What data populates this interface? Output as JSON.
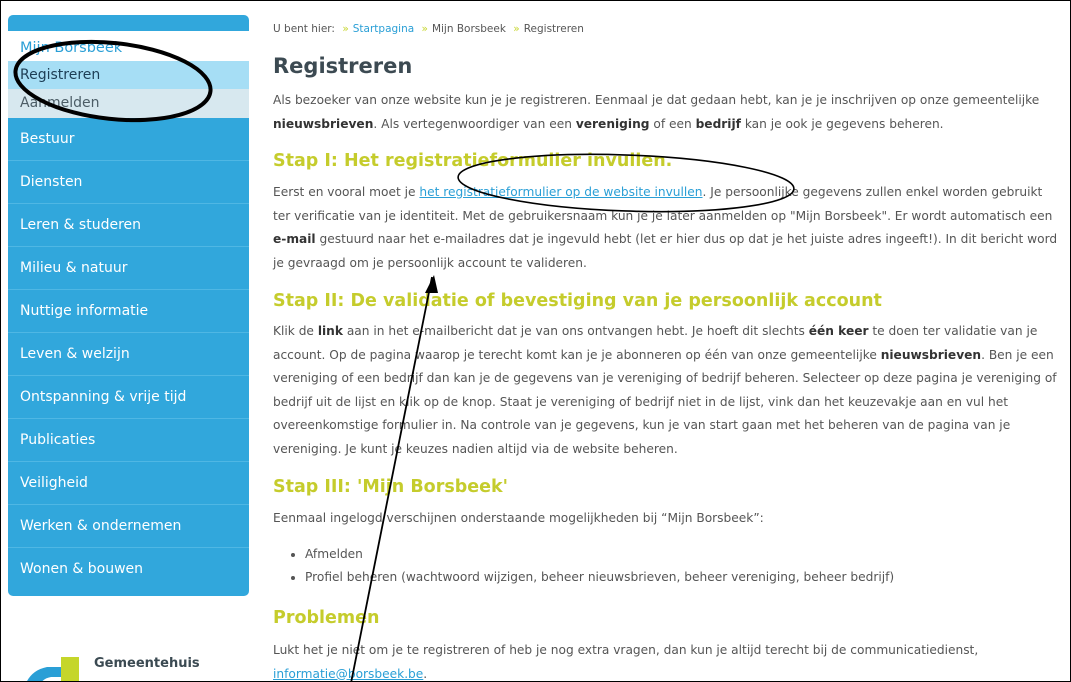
{
  "sidebar": {
    "sub_items": [
      {
        "label": "Mijn Borsbeek"
      },
      {
        "label": "Registreren"
      },
      {
        "label": "Aanmelden"
      }
    ],
    "nav_items": [
      {
        "label": "Bestuur"
      },
      {
        "label": "Diensten"
      },
      {
        "label": "Leren & studeren"
      },
      {
        "label": "Milieu & natuur"
      },
      {
        "label": "Nuttige informatie"
      },
      {
        "label": "Leven & welzijn"
      },
      {
        "label": "Ontspanning & vrije tijd"
      },
      {
        "label": "Publicaties"
      },
      {
        "label": "Veiligheid"
      },
      {
        "label": "Werken & ondernemen"
      },
      {
        "label": "Wonen & bouwen"
      }
    ],
    "footer_title": "Gemeentehuis"
  },
  "breadcrumb": {
    "prefix": "U bent hier:",
    "items": [
      "Startpagina",
      "Mijn Borsbeek",
      "Registreren"
    ],
    "separator": "»"
  },
  "page": {
    "title": "Registreren",
    "intro": {
      "t1": "Als bezoeker van onze website kun je je registreren. Eenmaal je dat gedaan hebt, kan je je inschrijven op onze gemeentelijke ",
      "b1": "nieuwsbrieven",
      "t2": ". Als vertegenwoordiger van een ",
      "b2": "vereniging",
      "t3": " of een ",
      "b3": "bedrijf",
      "t4": " kan je ook je gegevens beheren."
    },
    "step1": {
      "heading": "Stap I: Het registratieformulier invullen.",
      "t1": "Eerst en vooral moet je ",
      "link": "het registratieformulier op de website invullen",
      "t2": ". Je persoonlijke gegevens zullen enkel worden gebruikt ter verificatie van je identiteit. Met de gebruikersnaam kun je je later aanmelden op \"Mijn Borsbeek\". Er wordt automatisch een ",
      "b1": "e-mail",
      "t3": " gestuurd naar het e-mailadres dat je ingevuld hebt (let er hier dus op dat je het juiste adres ingeeft!). In dit bericht word je gevraagd om je persoonlijk account te valideren."
    },
    "step2": {
      "heading": "Stap II: De validatie of bevestiging van je persoonlijk account",
      "t1": "Klik de ",
      "b1": "link",
      "t2": " aan in het e-mailbericht dat je van ons ontvangen hebt. Je hoeft dit slechts ",
      "b2": "één keer",
      "t3": " te doen ter validatie van je account. Op de pagina waarop je terecht komt kan je je abonneren op één van onze gemeentelijke ",
      "b3": "nieuwsbrieven",
      "t4": ". Ben je een vereniging of een bedrijf dan kan je de gegevens van je vereniging of bedrijf beheren. Selecteer op deze pagina je vereniging of bedrijf uit de lijst en klik op de knop. Staat je vereniging of bedrijf niet in de lijst, vink dan het keuzevakje aan en vul het overeenkomstige formulier in. Na controle van je gegevens, kun je van start gaan met het beheren van de pagina van je vereniging. Je kunt je keuzes nadien altijd via de website beheren."
    },
    "step3": {
      "heading": "Stap III: 'Mijn Borsbeek'",
      "text": "Eenmaal ingelogd verschijnen onderstaande mogelijkheden bij “Mijn Borsbeek”:",
      "options": [
        "Afmelden",
        "Profiel beheren (wachtwoord wijzigen, beheer nieuwsbrieven, beheer vereniging, beheer bedrijf)"
      ]
    },
    "problems": {
      "heading": "Problemen",
      "text": "Lukt het je niet om je te registreren of heb je nog extra vragen, dan kun je altijd terecht bij de communicatiedienst,",
      "email": "informatie@borsbeek.be",
      "end": "."
    }
  },
  "colors": {
    "sidebar_blue": "#31a7dc",
    "active_item": "#a6def5",
    "heading_green": "#c5cc2c",
    "link_blue": "#2a9fd6"
  }
}
